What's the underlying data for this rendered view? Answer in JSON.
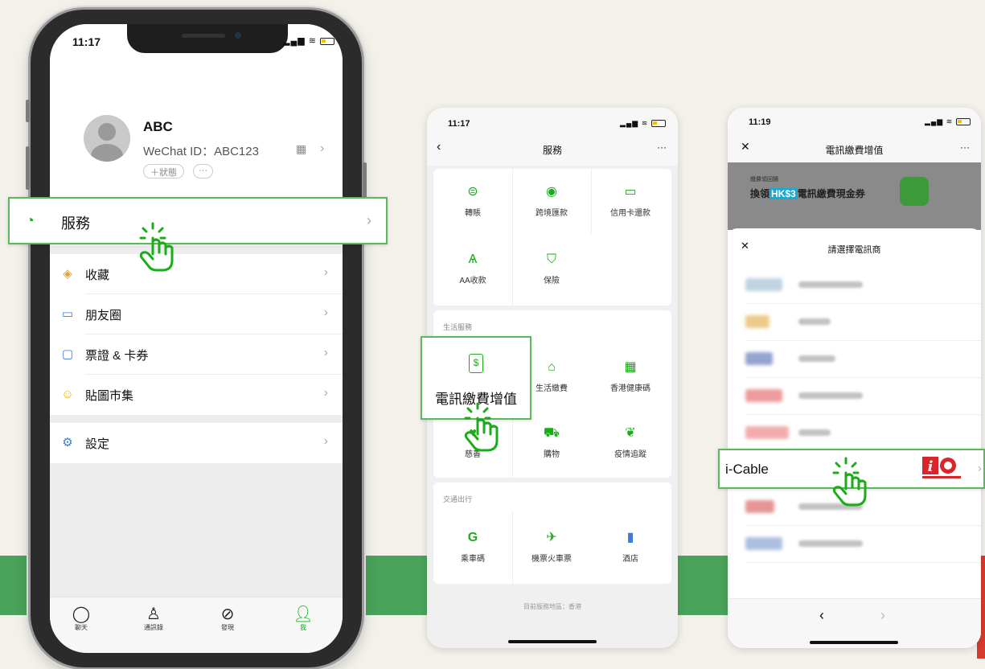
{
  "phone1": {
    "status_time": "11:17",
    "profile": {
      "name": "ABC",
      "wechat_id": "WeChat ID：ABC123",
      "status_pill": "＋狀態",
      "more_pill": "···"
    },
    "menu": [
      {
        "label": "服務",
        "icon": "service-icon"
      },
      {
        "label": "收藏",
        "icon": "favorites-icon"
      },
      {
        "label": "朋友圈",
        "icon": "moments-icon"
      },
      {
        "label": "票證 & 卡券",
        "icon": "cards-icon"
      },
      {
        "label": "貼圖市集",
        "icon": "sticker-icon"
      },
      {
        "label": "設定",
        "icon": "settings-icon"
      }
    ],
    "tabs": [
      {
        "label": "聊天",
        "icon": "chat-icon"
      },
      {
        "label": "通訊錄",
        "icon": "contacts-icon"
      },
      {
        "label": "發現",
        "icon": "discover-icon"
      },
      {
        "label": "我",
        "icon": "me-icon"
      }
    ]
  },
  "phone2": {
    "status_time": "11:17",
    "title": "服務",
    "more": "···",
    "top_items": [
      "轉賬",
      "跨境匯款",
      "信用卡還款",
      "AA收款",
      "保險"
    ],
    "life_section_title": "生活服務",
    "life_items": [
      "電訊繳費增值",
      "生活繳費",
      "香港健康碼",
      "慈善",
      "購物",
      "疫情追蹤"
    ],
    "travel_section_title": "交通出行",
    "travel_items": [
      "乘車碼",
      "機票火車票",
      "酒店"
    ],
    "footer": "目前服務地區：香港"
  },
  "phone3": {
    "status_time": "11:19",
    "title": "電訊繳費增值",
    "more": "···",
    "banner_small": "繳費領回饋",
    "banner_prefix": "換領",
    "banner_tag": "HK$3",
    "banner_suffix": "電訊繳費現金券",
    "sheet_title": "請選擇電訊商",
    "highlight_carrier": "i-Cable",
    "nav_back": "‹",
    "nav_forward": "›"
  },
  "colors": {
    "accent": "#1aad19",
    "highlight_border": "#5cb85c",
    "band_green": "#4aa35a",
    "band_red": "#d63b2e"
  }
}
